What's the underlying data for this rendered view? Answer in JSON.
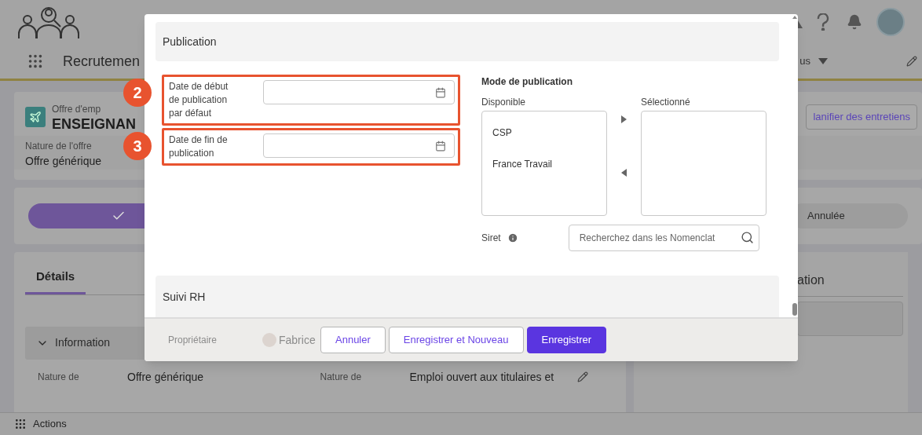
{
  "header": {
    "app_name": "Recrutemen",
    "nav_item": "us"
  },
  "record": {
    "type": "Offre d'emp",
    "title": "ENSEIGNAN",
    "field_label": "Nature de l'offre",
    "field_value": "Offre générique",
    "action_button": "lanifier des entretiens"
  },
  "path": [
    {
      "kind": "complete"
    },
    {
      "kind": "stage",
      "label": "Annulée"
    }
  ],
  "details": {
    "tabs": [
      {
        "label": "Détails",
        "selected": true
      }
    ],
    "section": {
      "label": "Information",
      "expanded": true
    },
    "fields": [
      {
        "label": "Nature de",
        "value": "Offre générique",
        "editable": false
      },
      {
        "label": "Nature de",
        "value": "Emploi ouvert aux titulaires et",
        "editable": true
      }
    ]
  },
  "side_panel": {
    "title": "ation"
  },
  "bottom_bar": {
    "label": "Actions"
  },
  "modal": {
    "section_title": "Publication",
    "date_fields": [
      {
        "label": "Date de début de publication par défaut",
        "marker": "2"
      },
      {
        "label": "Date de fin de publication",
        "marker": "3"
      }
    ],
    "publication_mode": {
      "title": "Mode de publication",
      "available_label": "Disponible",
      "selected_label": "Sélectionné",
      "available": [
        "CSP",
        "France Travail"
      ]
    },
    "siret": {
      "label": "Siret",
      "placeholder": "Recherchez dans les Nomenclat"
    },
    "next_section_title": "Suivi RH",
    "faded_field": {
      "label": "Propriétaire",
      "value": "Fabrice"
    },
    "buttons": [
      {
        "label": "Annuler",
        "kind": "secondary"
      },
      {
        "label": "Enregistrer et Nouveau",
        "kind": "secondary"
      },
      {
        "label": "Enregistrer",
        "kind": "primary"
      }
    ]
  }
}
